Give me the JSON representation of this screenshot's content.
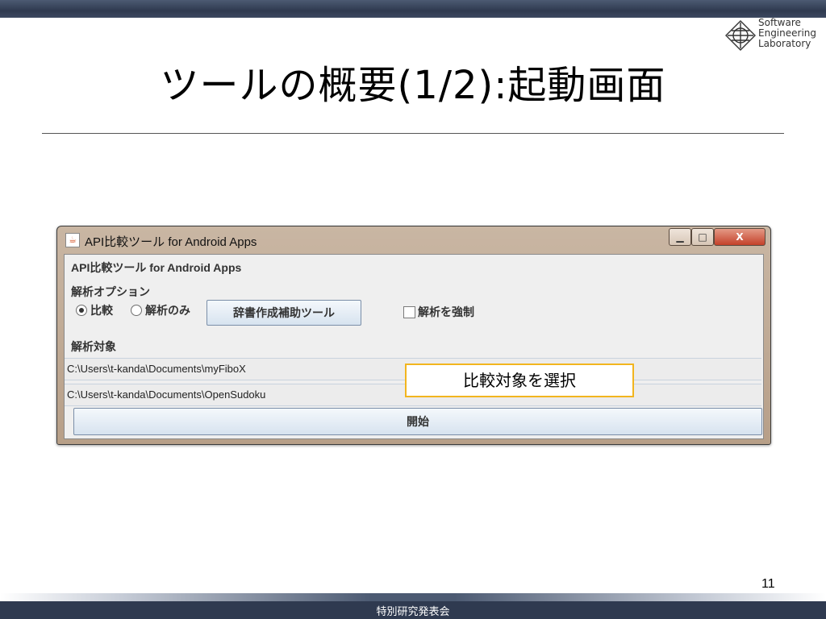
{
  "slide": {
    "title": "ツールの概要(1/2):起動画面",
    "page_number": "11",
    "footer": "特別研究発表会"
  },
  "logo": {
    "line1": "Software",
    "line2": "Engineering",
    "line3": "Laboratory"
  },
  "window": {
    "title": "API比較ツール for Android Apps",
    "min_glyph": "▁",
    "max_glyph": "□",
    "close_glyph": "X",
    "heading": "API比較ツール for Android Apps",
    "options_label": "解析オプション",
    "radio_compare": "比較",
    "radio_analyze": "解析のみ",
    "dictionary_button": "辞書作成補助ツール",
    "force_analyze": "解析を強制",
    "targets_label": "解析対象",
    "path1": "C:\\Users\\t-kanda\\Documents\\myFiboX",
    "path2": "C:\\Users\\t-kanda\\Documents\\OpenSudoku",
    "start_button": "開始"
  },
  "callout": {
    "text": "比較対象を選択"
  },
  "colors": {
    "header_bar": "#2f3a50",
    "callout_border": "#f2b51f",
    "window_frame": "#c9b6a3"
  }
}
